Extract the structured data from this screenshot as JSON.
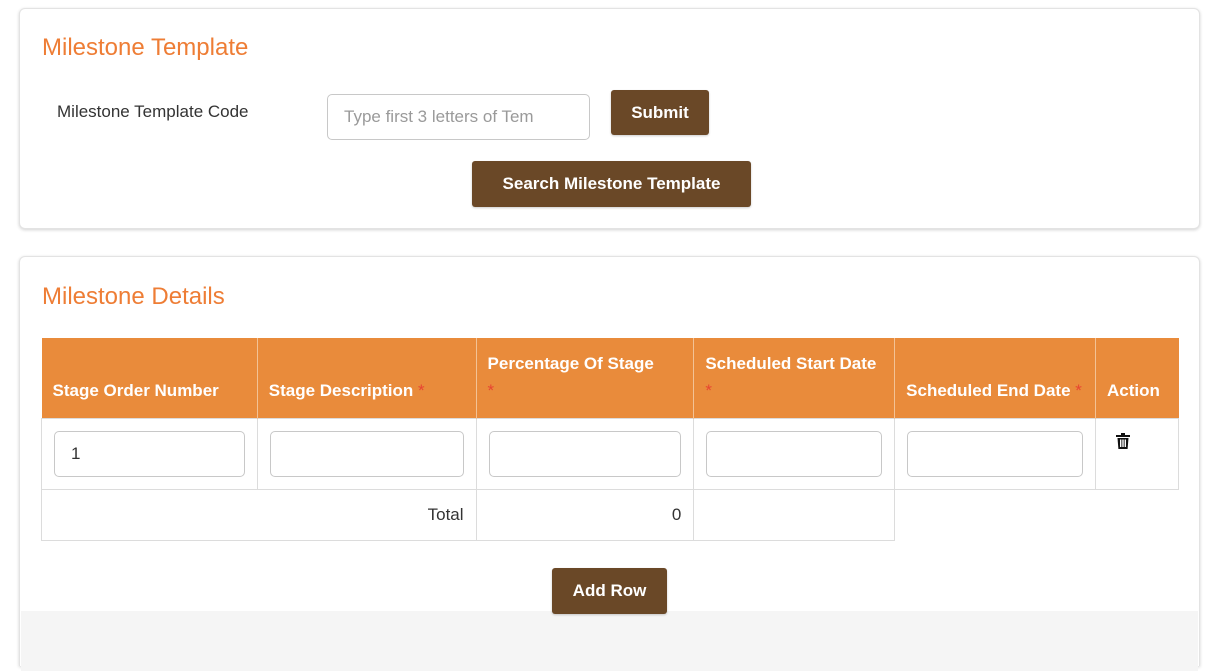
{
  "template_panel": {
    "title": "Milestone Template",
    "code_label": "Milestone Template Code",
    "code_input": {
      "value": "",
      "placeholder": "Type first 3 letters of Tem"
    },
    "submit_label": "Submit",
    "search_label": "Search Milestone Template"
  },
  "details_panel": {
    "title": "Milestone Details",
    "columns": [
      {
        "label": "Stage Order Number",
        "required": false
      },
      {
        "label": "Stage Description",
        "required": true
      },
      {
        "label": "Percentage Of Stage",
        "required": true
      },
      {
        "label": "Scheduled Start Date",
        "required": true
      },
      {
        "label": "Scheduled End Date",
        "required": true
      },
      {
        "label": "Action",
        "required": false
      }
    ],
    "required_mark": "*",
    "rows": [
      {
        "stage_order": "1",
        "description": "",
        "percentage": "",
        "start_date": "",
        "end_date": ""
      }
    ],
    "total_label": "Total",
    "total_value": "0",
    "add_row_label": "Add Row",
    "delete_icon": "trash-icon"
  },
  "colors": {
    "accent_orange": "#ee7d35",
    "header_orange": "#e98b3b",
    "button_brown": "#6a4827",
    "required_red": "#e84532"
  }
}
